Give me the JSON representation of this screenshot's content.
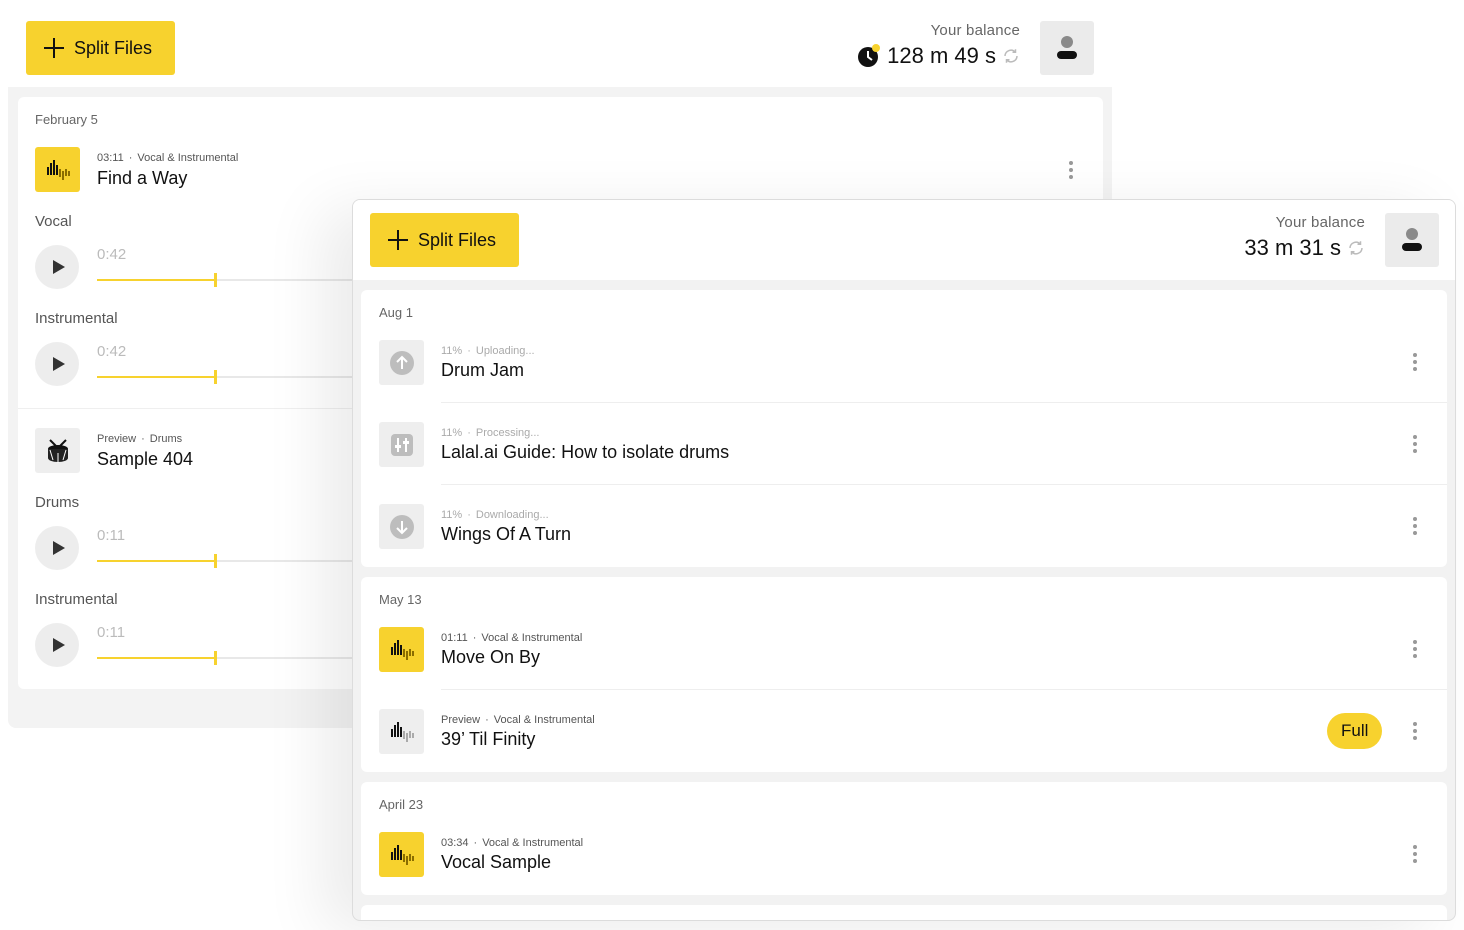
{
  "back": {
    "split_label": "Split Files",
    "balance_label": "Your balance",
    "balance_value": "128 m 49 s",
    "groups": [
      {
        "date": "February 5",
        "items": [
          {
            "duration": "03:11",
            "type": "Vocal & Instrumental",
            "title": "Find a Way",
            "stems": [
              {
                "label": "Vocal",
                "time": "0:42"
              },
              {
                "label": "Instrumental",
                "time": "0:42"
              }
            ]
          },
          {
            "duration": "Preview",
            "type": "Drums",
            "title": "Sample 404",
            "stems": [
              {
                "label": "Drums",
                "time": "0:11"
              },
              {
                "label": "Instrumental",
                "time": "0:11"
              }
            ]
          }
        ]
      }
    ]
  },
  "front": {
    "split_label": "Split Files",
    "balance_label": "Your balance",
    "balance_value": "33 m 31 s",
    "groups": [
      {
        "date": "Aug 1",
        "items": [
          {
            "progress": "11%",
            "status": "Uploading...",
            "title": "Drum Jam",
            "icon": "upload-icon"
          },
          {
            "progress": "11%",
            "status": "Processing...",
            "title": "Lalal.ai Guide: How to isolate drums",
            "icon": "processing-icon"
          },
          {
            "progress": "11%",
            "status": "Downloading...",
            "title": "Wings Of A Turn",
            "icon": "download-icon"
          }
        ]
      },
      {
        "date": "May 13",
        "items": [
          {
            "duration": "01:11",
            "type": "Vocal & Instrumental",
            "title": "Move On By",
            "icon": "waveform-icon"
          },
          {
            "duration": "Preview",
            "type": "Vocal & Instrumental",
            "title": "39’ Til Finity",
            "icon": "waveform-icon",
            "badge": "Full"
          }
        ]
      },
      {
        "date": "April 23",
        "items": [
          {
            "duration": "03:34",
            "type": "Vocal & Instrumental",
            "title": "Vocal Sample",
            "icon": "waveform-icon"
          }
        ]
      }
    ]
  },
  "colors": {
    "accent": "#f7d22e",
    "panel": "#f2f2f2"
  }
}
